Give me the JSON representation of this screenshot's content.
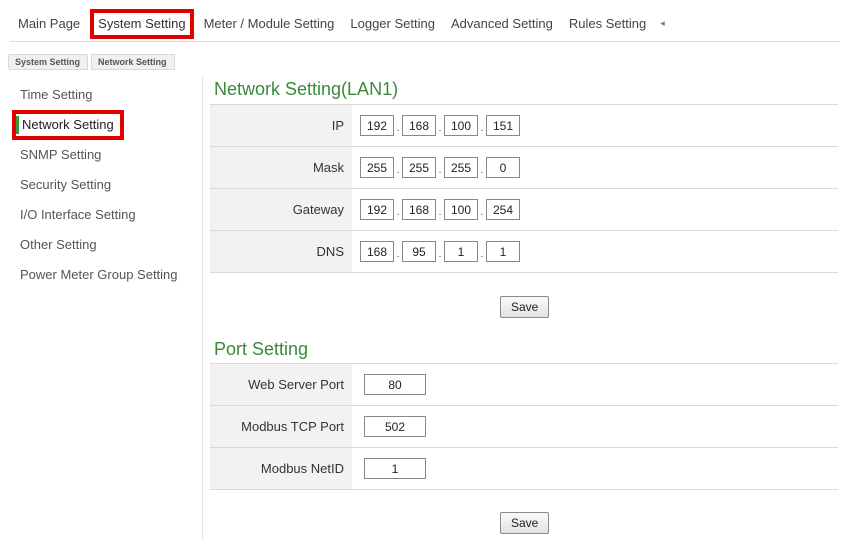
{
  "topnav": {
    "tabs": [
      {
        "label": "Main Page"
      },
      {
        "label": "System Setting",
        "active": true
      },
      {
        "label": "Meter / Module Setting"
      },
      {
        "label": "Logger Setting"
      },
      {
        "label": "Advanced Setting"
      },
      {
        "label": "Rules Setting"
      }
    ],
    "more_glyph": "◂"
  },
  "breadcrumb": [
    "System Setting",
    "Network Setting"
  ],
  "sidebar": {
    "items": [
      {
        "label": "Time Setting"
      },
      {
        "label": "Network Setting",
        "active": true
      },
      {
        "label": "SNMP Setting"
      },
      {
        "label": "Security Setting"
      },
      {
        "label": "I/O Interface Setting"
      },
      {
        "label": "Other Setting"
      },
      {
        "label": "Power Meter Group Setting"
      }
    ]
  },
  "network": {
    "title": "Network Setting(LAN1)",
    "rows": [
      {
        "label": "IP",
        "octets": [
          "192",
          "168",
          "100",
          "151"
        ]
      },
      {
        "label": "Mask",
        "octets": [
          "255",
          "255",
          "255",
          "0"
        ]
      },
      {
        "label": "Gateway",
        "octets": [
          "192",
          "168",
          "100",
          "254"
        ]
      },
      {
        "label": "DNS",
        "octets": [
          "168",
          "95",
          "1",
          "1"
        ]
      }
    ],
    "save_label": "Save"
  },
  "port": {
    "title": "Port Setting",
    "rows": [
      {
        "label": "Web Server Port",
        "value": "80"
      },
      {
        "label": "Modbus TCP Port",
        "value": "502"
      },
      {
        "label": "Modbus NetID",
        "value": "1"
      }
    ],
    "save_label": "Save"
  },
  "colors": {
    "accent_green": "#3a8a3a",
    "highlight_red": "#e00000"
  }
}
